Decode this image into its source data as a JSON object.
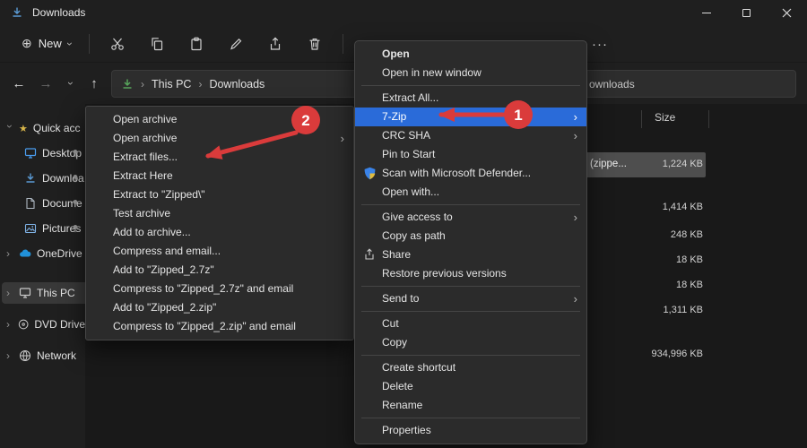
{
  "window": {
    "title": "Downloads"
  },
  "toolbar": {
    "new_label": "New"
  },
  "navbar": {
    "path": [
      "This PC",
      "Downloads"
    ],
    "search_text": "ownloads"
  },
  "filelist": {
    "size_column": "Size",
    "selected_row": {
      "name": "(zippe...",
      "size": "1,224 KB"
    },
    "rows": [
      {
        "size": "1,414 KB"
      },
      {
        "size": "248 KB"
      },
      {
        "size": "18 KB"
      },
      {
        "size": "18 KB"
      },
      {
        "size": "1,311 KB"
      },
      {
        "size": "934,996 KB"
      }
    ]
  },
  "sidebar": {
    "items": [
      {
        "label": "Quick acc"
      },
      {
        "label": "Desktop"
      },
      {
        "label": "Downloa"
      },
      {
        "label": "Docume"
      },
      {
        "label": "Pictures"
      },
      {
        "label": "OneDrive"
      },
      {
        "label": "This PC"
      },
      {
        "label": "DVD Drive"
      },
      {
        "label": "Network"
      }
    ]
  },
  "context_menu": {
    "items": [
      "Open",
      "Open in new window",
      "Extract All...",
      "7-Zip",
      "CRC SHA",
      "Pin to Start",
      "Scan with Microsoft Defender...",
      "Open with...",
      "Give access to",
      "Copy as path",
      "Share",
      "Restore previous versions",
      "Send to",
      "Cut",
      "Copy",
      "Create shortcut",
      "Delete",
      "Rename",
      "Properties"
    ]
  },
  "submenu": {
    "items": [
      "Open archive",
      "Open archive",
      "Extract files...",
      "Extract Here",
      "Extract to \"Zipped\\\"",
      "Test archive",
      "Add to archive...",
      "Compress and email...",
      "Add to \"Zipped_2.7z\"",
      "Compress to \"Zipped_2.7z\" and email",
      "Add to \"Zipped_2.zip\"",
      "Compress to \"Zipped_2.zip\" and email"
    ]
  },
  "annotations": {
    "step1": "1",
    "step2": "2"
  },
  "icons": {
    "chevron_right": "›",
    "back_arrow": "←",
    "forward_arrow": "→",
    "up_arrow": "↑",
    "sort_glyph": "↑↓",
    "star": "★",
    "plus": "⊕",
    "more_dots": "···",
    "breadcrumb_sep": "›"
  },
  "colors": {
    "accent_highlight": "#2a6bd9",
    "annotation_red": "#da3b3b",
    "selection_gray": "#4e4e4e"
  }
}
